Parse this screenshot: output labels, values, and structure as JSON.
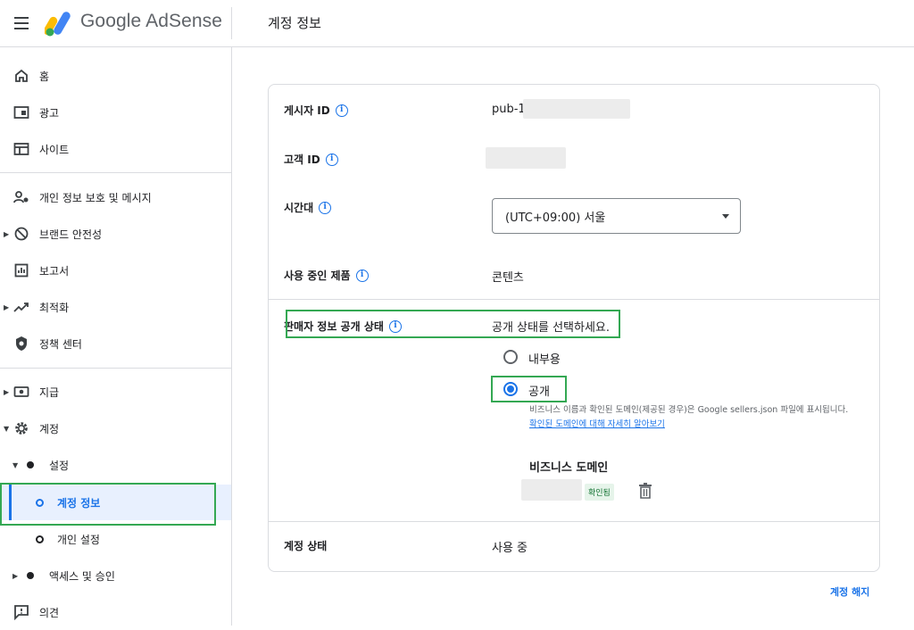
{
  "header": {
    "brand": "Google AdSense",
    "page_title": "계정 정보"
  },
  "sidebar": {
    "items": [
      {
        "label": "홈",
        "icon": "home-icon"
      },
      {
        "label": "광고",
        "icon": "ads-icon"
      },
      {
        "label": "사이트",
        "icon": "sites-icon"
      },
      {
        "label": "개인 정보 보호 및 메시지",
        "icon": "privacy-icon"
      },
      {
        "label": "브랜드 안전성",
        "icon": "block-icon"
      },
      {
        "label": "보고서",
        "icon": "reports-icon"
      },
      {
        "label": "최적화",
        "icon": "trending-icon"
      },
      {
        "label": "정책 센터",
        "icon": "policy-shield-icon"
      },
      {
        "label": "지급",
        "icon": "payments-icon"
      },
      {
        "label": "계정",
        "icon": "gear-icon"
      },
      {
        "label": "설정"
      },
      {
        "label": "계정 정보"
      },
      {
        "label": "개인 설정"
      },
      {
        "label": "액세스 및 승인"
      },
      {
        "label": "의견",
        "icon": "feedback-icon"
      }
    ]
  },
  "account": {
    "publisher_id_label": "게시자 ID",
    "publisher_id_value": "pub-1",
    "customer_id_label": "고객 ID",
    "timezone_label": "시간대",
    "timezone_value": "(UTC+09:00) 서울",
    "products_label": "사용 중인 제품",
    "products_value": "콘텐츠",
    "seller_info_label": "판매자 정보 공개 상태",
    "seller_info_prompt": "공개 상태를 선택하세요.",
    "option_internal": "내부용",
    "option_public": "공개",
    "help_text": "비즈니스 이름과 확인된 도메인(제공된 경우)은 Google sellers.json 파일에 표시됩니다.",
    "help_link": "확인된 도메인에 대해 자세히 알아보기",
    "business_domain_title": "비즈니스 도메인",
    "verified_badge": "확인됨",
    "status_label": "계정 상태",
    "status_value": "사용 중"
  },
  "footer": {
    "close_account": "계정 해지"
  },
  "colors": {
    "accent": "#1a73e8",
    "highlight": "#34a853",
    "verified_bg": "#e6f4ea",
    "verified_text": "#137333"
  }
}
